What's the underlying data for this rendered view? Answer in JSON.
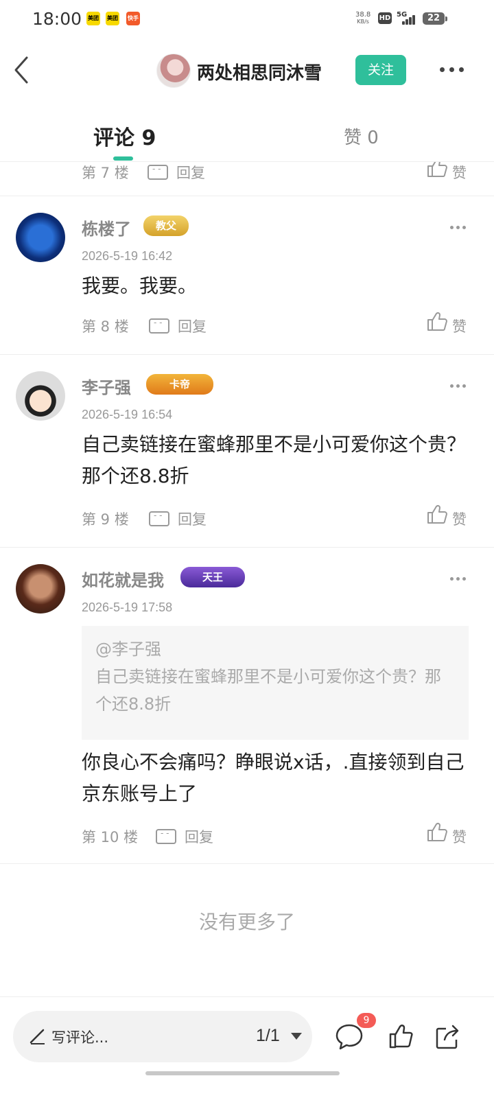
{
  "status_bar": {
    "time": "18:00",
    "app_icons": [
      "美团",
      "美团",
      "快手"
    ],
    "net_speed_value": "38.8",
    "net_speed_unit": "KB/s",
    "hd": "HD",
    "network": "5G",
    "battery": "22"
  },
  "header": {
    "author_name": "两处相思同沐雪",
    "follow_label": "关注"
  },
  "tabs": {
    "comments_label": "评论 9",
    "likes_label": "赞 0"
  },
  "partial_row": {
    "floor": "第 7 楼",
    "reply_label": "回复",
    "like_label": "赞"
  },
  "comments": [
    {
      "user": "栋楼了",
      "badge": "教父",
      "time": "2026-5-19 16:42",
      "text": "我要。我要。",
      "floor": "第 8 楼",
      "reply_label": "回复",
      "like_label": "赞"
    },
    {
      "user": "李子强",
      "badge": "卡帝",
      "time": "2026-5-19 16:54",
      "text": "自己卖链接在蜜蜂那里不是小可爱你这个贵？那个还8.8折",
      "floor": "第 9 楼",
      "reply_label": "回复",
      "like_label": "赞"
    },
    {
      "user": "如花就是我",
      "badge": "天王",
      "time": "2026-5-19 17:58",
      "quote_user": "@李子强",
      "quote_text": "自己卖链接在蜜蜂那里不是小可爱你这个贵？那个还8.8折",
      "text": "你良心不会痛吗？睁眼说x话，.直接领到自己京东账号上了",
      "floor": "第 10 楼",
      "reply_label": "回复",
      "like_label": "赞"
    }
  ],
  "no_more_label": "没有更多了",
  "bottom_bar": {
    "write_placeholder": "写评论...",
    "page_indicator": "1/1",
    "comment_count": "9"
  },
  "colors": {
    "accent": "#2fbf9b",
    "badge_red": "#f45b56"
  }
}
